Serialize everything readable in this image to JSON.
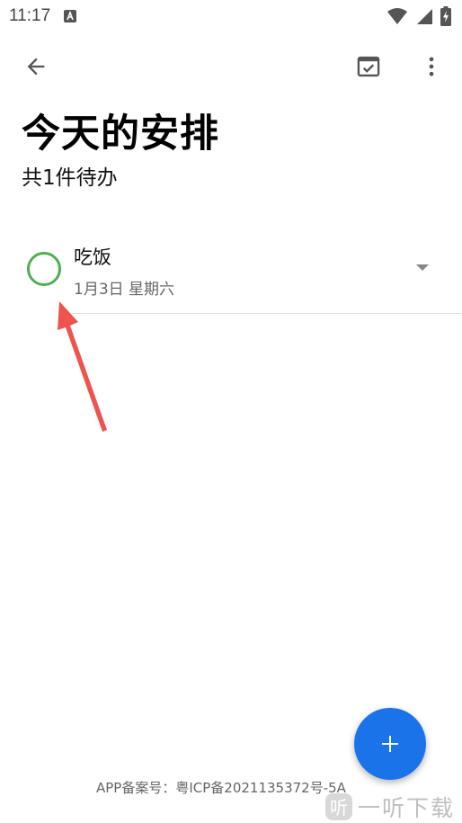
{
  "status_bar": {
    "time": "11:17",
    "notification_icon": "a-notification-icon",
    "wifi_icon": "wifi-icon",
    "signal_icon": "cell-signal-icon",
    "battery_icon": "battery-charging-icon"
  },
  "toolbar": {
    "back_icon": "arrow-back-icon",
    "complete_icon": "calendar-check-icon",
    "more_icon": "more-vert-icon"
  },
  "header": {
    "title": "今天的安排",
    "subtitle": "共1件待办"
  },
  "tasks": [
    {
      "title": "吃饭",
      "date": "1月3日 星期六",
      "checkbox_color": "#4caf50",
      "expand_icon": "dropdown-arrow-icon"
    }
  ],
  "annotation": {
    "arrow_color": "#ef5350"
  },
  "fab": {
    "icon": "plus-icon",
    "color": "#1a73e8"
  },
  "footer": {
    "icp": "APP备案号：粤ICP备2021135372号-5A"
  },
  "watermark": {
    "logo_text": "听",
    "text": "一听下载"
  }
}
